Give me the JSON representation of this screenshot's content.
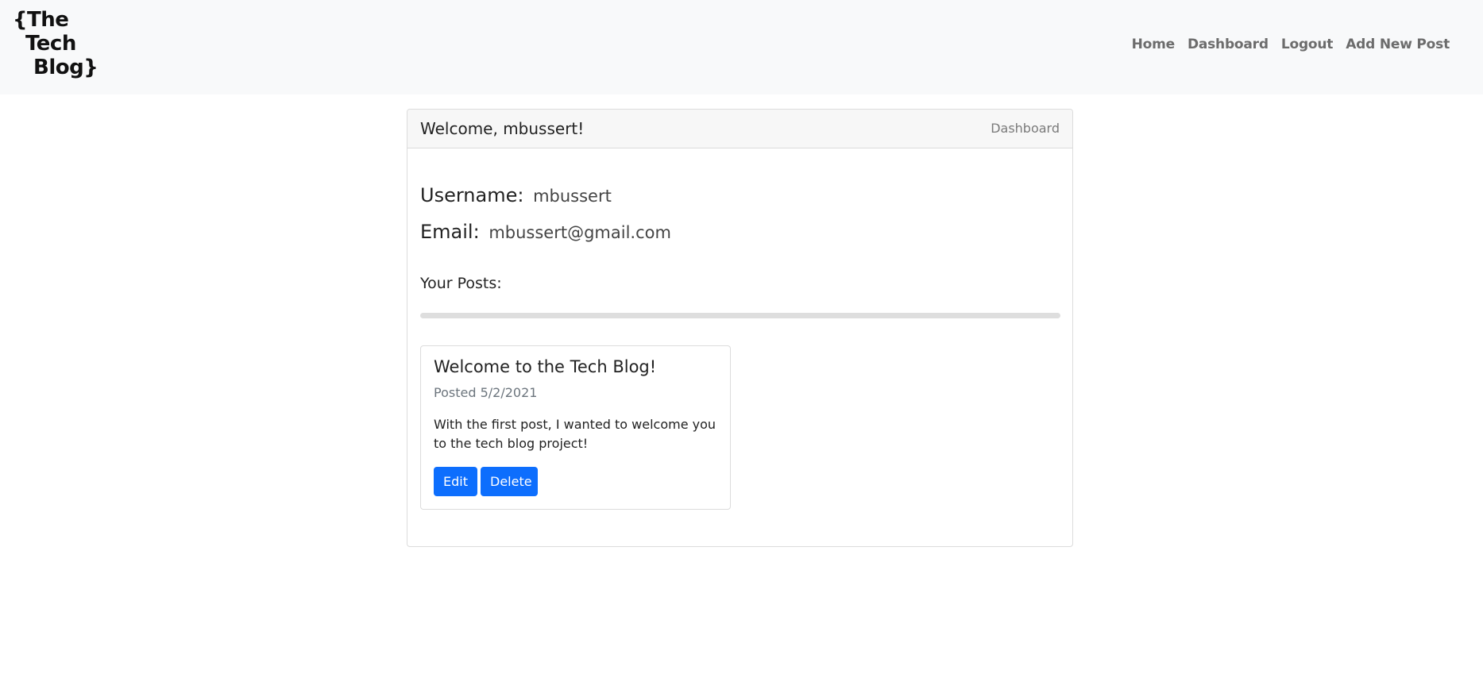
{
  "navbar": {
    "logo_lines": [
      "{The",
      "Tech",
      "Blog}"
    ],
    "links": [
      "Home",
      "Dashboard",
      "Logout",
      "Add New Post"
    ]
  },
  "card": {
    "header_title": "Welcome, mbussert!",
    "header_label": "Dashboard",
    "username_label": "Username:",
    "username_value": "mbussert",
    "email_label": "Email:",
    "email_value": "mbussert@gmail.com",
    "posts_heading": "Your Posts:"
  },
  "posts": [
    {
      "title": "Welcome to the Tech Blog!",
      "date": "Posted 5/2/2021",
      "body": "With the first post, I wanted to welcome you to the tech blog project!",
      "edit_label": "Edit",
      "delete_label": "Delete"
    }
  ],
  "colors": {
    "primary": "#0d6efd",
    "navbar_bg": "#f8f9fa",
    "muted": "#6c757d"
  }
}
